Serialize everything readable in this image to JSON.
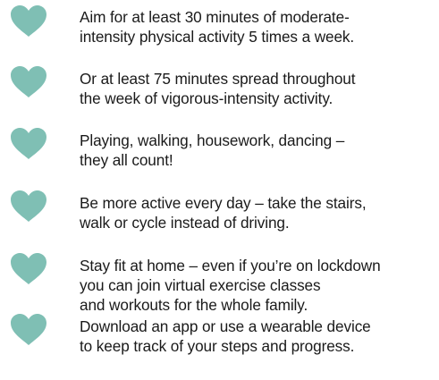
{
  "colors": {
    "heart": "#7fbfb4",
    "text": "#1a1a1a",
    "background": "#ffffff"
  },
  "icon": "heart-icon",
  "items": [
    {
      "lines": [
        "Aim for at least 30 minutes of moderate-",
        "intensity physical activity 5 times a week."
      ]
    },
    {
      "lines": [
        "Or at least 75 minutes spread throughout",
        "the week of vigorous-intensity activity."
      ]
    },
    {
      "lines": [
        "Playing, walking, housework, dancing –",
        "they all count!"
      ]
    },
    {
      "lines": [
        "Be more active every day – take the stairs,",
        "walk or cycle instead of driving."
      ]
    },
    {
      "lines": [
        "Stay fit at home – even if you’re on lockdown",
        "you can join virtual exercise classes",
        "and workouts for the whole family."
      ]
    },
    {
      "lines": [
        "Download an app or use a wearable device",
        "to keep track of your steps and progress."
      ]
    }
  ]
}
